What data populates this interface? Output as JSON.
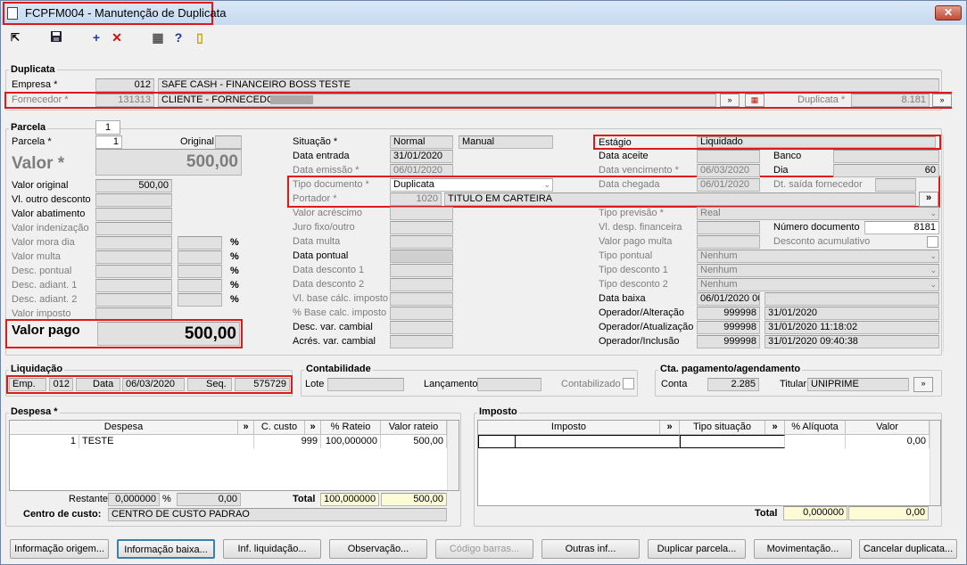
{
  "window": {
    "title": "FCPFM004 - Manutenção de Duplicata",
    "close": "✕"
  },
  "toolbar": {
    "exit": "⇱",
    "save": "💾",
    "add": "+",
    "delete": "✕",
    "calc": "▦",
    "help": "?",
    "door": "▯"
  },
  "duplicata": {
    "section": "Duplicata",
    "empresa_label": "Empresa *",
    "empresa_code": "012",
    "empresa_name": "SAFE CASH - FINANCEIRO BOSS TESTE",
    "fornecedor_label": "Fornecedor *",
    "fornecedor_code": "131313",
    "fornecedor_name": "CLIENTE - FORNECEDOR",
    "duplicata_label": "Duplicata *",
    "duplicata_value": "8.181"
  },
  "parcela": {
    "section": "Parcela",
    "tab": "1",
    "parcela_label": "Parcela *",
    "parcela_value": "1",
    "original_label": "Original",
    "valor_label": "Valor *",
    "valor_value": "500,00",
    "valor_original_label": "Valor original",
    "valor_original": "500,00",
    "outro_desc_label": "Vl. outro desconto",
    "abatimento_label": "Valor abatimento",
    "indenizacao_label": "Valor indenização",
    "mora_label": "Valor mora dia",
    "multa_label": "Valor multa",
    "desc_pontual_label": "Desc. pontual",
    "desc_adiant1_label": "Desc. adiant. 1",
    "desc_adiant2_label": "Desc. adiant. 2",
    "imposto_label": "Valor imposto",
    "pct": "%",
    "valor_pago_label": "Valor pago",
    "valor_pago": "500,00"
  },
  "mid": {
    "situacao_label": "Situação *",
    "situacao": "Normal",
    "situacao2": "Manual",
    "data_entrada_label": "Data entrada",
    "data_entrada": "31/01/2020",
    "data_emissao_label": "Data emissão *",
    "data_emissao": "06/01/2020",
    "tipo_doc_label": "Tipo documento *",
    "tipo_doc": "Duplicata",
    "portador_label": "Portador *",
    "portador_code": "1020",
    "portador_name": "TITULO EM CARTEIRA",
    "acrescimo_label": "Valor acréscimo",
    "juro_label": "Juro fixo/outro",
    "data_multa_label": "Data multa",
    "data_pontual_label": "Data pontual",
    "data_desc1_label": "Data desconto 1",
    "data_desc2_label": "Data desconto 2",
    "vl_base_label": "Vl. base cálc. imposto",
    "pct_base_label": "% Base calc. imposto",
    "desc_var_label": "Desc. var. cambial",
    "acres_var_label": "Acrés. var. cambial"
  },
  "right": {
    "estagio_label": "Estágio",
    "estagio": "Liquidado",
    "data_aceite_label": "Data aceite",
    "banco_label": "Banco",
    "data_venc_label": "Data vencimento *",
    "data_venc": "06/03/2020",
    "dia_label": "Dia",
    "dia": "60",
    "data_chegada_label": "Data chegada",
    "data_chegada": "06/01/2020",
    "dt_saida_label": "Dt. saída fornecedor",
    "tipo_prev_label": "Tipo previsão *",
    "tipo_prev": "Real",
    "vl_desp_label": "Vl. desp. financeira",
    "num_doc_label": "Número documento",
    "num_doc": "8181",
    "vl_pago_multa_label": "Valor pago multa",
    "desc_acum_label": "Desconto acumulativo",
    "tipo_pontual_label": "Tipo pontual",
    "tipo_desc1_label": "Tipo desconto 1",
    "tipo_desc2_label": "Tipo desconto 2",
    "nenhum": "Nenhum",
    "data_baixa_label": "Data baixa",
    "data_baixa": "06/01/2020 00",
    "op_alt_label": "Operador/Alteração",
    "op_alt_code": "999998",
    "op_alt_date": "31/01/2020",
    "op_atu_label": "Operador/Atualização",
    "op_atu_code": "999998",
    "op_atu_date": "31/01/2020 11:18:02",
    "op_inc_label": "Operador/Inclusão",
    "op_inc_code": "999998",
    "op_inc_date": "31/01/2020 09:40:38"
  },
  "liquidacao": {
    "section": "Liquidação",
    "emp_label": "Emp.",
    "emp": "012",
    "data_label": "Data",
    "data": "06/03/2020",
    "seq_label": "Seq.",
    "seq": "575729"
  },
  "contabilidade": {
    "section": "Contabilidade",
    "lote_label": "Lote",
    "lanc_label": "Lançamento",
    "contab_label": "Contabilizado"
  },
  "cta": {
    "section": "Cta. pagamento/agendamento",
    "conta_label": "Conta",
    "conta": "2.285",
    "titular_label": "Titular",
    "titular": "UNIPRIME"
  },
  "despesa": {
    "section": "Despesa *",
    "headers": [
      "Despesa",
      "»",
      "C. custo",
      "»",
      "% Rateio",
      "Valor rateio"
    ],
    "row": {
      "code": "1",
      "name": "TESTE",
      "ccusto": "999",
      "rateio": "100,000000",
      "valor": "500,00"
    },
    "restante_label": "Restante",
    "restante_pct": "0,000000",
    "pct": "%",
    "restante_val": "0,00",
    "total_label": "Total",
    "total_pct": "100,000000",
    "total_val": "500,00",
    "cc_label": "Centro de custo:",
    "cc_value": "CENTRO DE CUSTO PADRAO"
  },
  "imposto": {
    "section": "Imposto",
    "headers": [
      "Imposto",
      "»",
      "Tipo situação",
      "»",
      "% Alíquota",
      "Valor"
    ],
    "row_valor": "0,00",
    "total_label": "Total",
    "total_pct": "0,000000",
    "total_val": "0,00"
  },
  "buttons": [
    "Informação origem...",
    "Informação baixa...",
    "Inf. liquidação...",
    "Observação...",
    "Código barras...",
    "Outras inf...",
    "Duplicar parcela...",
    "Movimentação...",
    "Cancelar duplicata..."
  ],
  "arrows": {
    "more": "»",
    "dd": "⌄",
    "cal": "▦"
  }
}
